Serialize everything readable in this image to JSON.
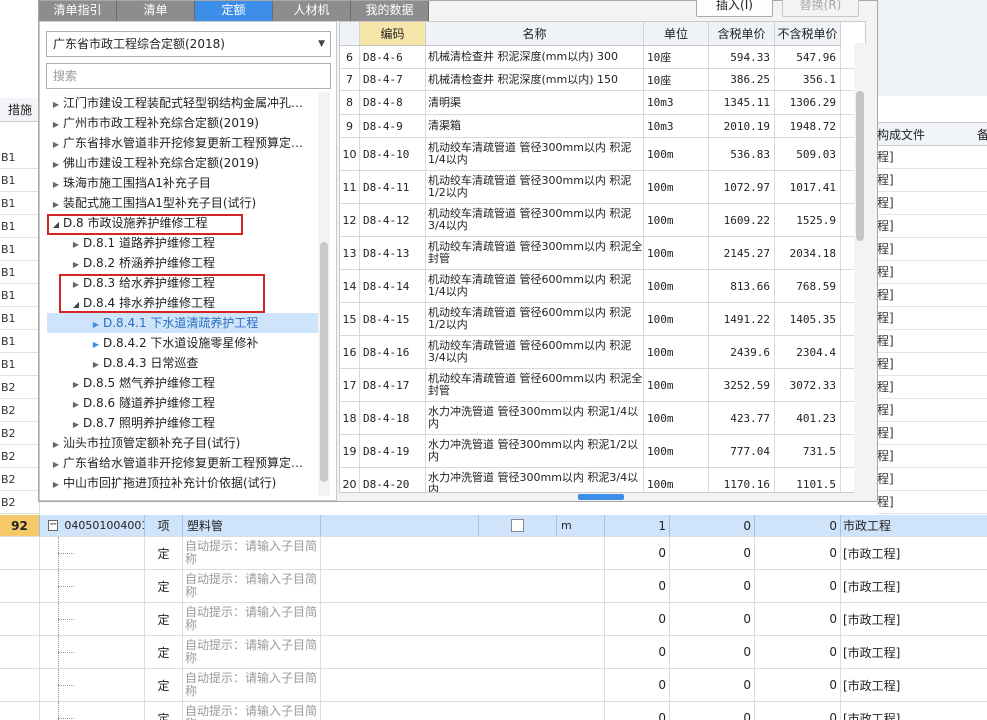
{
  "dialog": {
    "tabs": [
      "清单指引",
      "清单",
      "定额",
      "人材机",
      "我的数据"
    ],
    "active_tab": "定额",
    "insert_label": "插入(I)",
    "replace_label": "替换(R)",
    "library_select": "广东省市政工程综合定额(2018)",
    "search_placeholder": "搜索",
    "tree": [
      {
        "text": "江门市建设工程装配式轻型钢结构金属冲孔…",
        "arrow": "collapsed"
      },
      {
        "text": "广州市市政工程补充综合定额(2019)",
        "arrow": "collapsed"
      },
      {
        "text": "广东省排水管道非开挖修复更新工程预算定…",
        "arrow": "collapsed"
      },
      {
        "text": "佛山市建设工程补充综合定额(2019)",
        "arrow": "collapsed"
      },
      {
        "text": "珠海市施工围挡A1补充子目",
        "arrow": "collapsed"
      },
      {
        "text": "装配式施工围挡A1型补充子目(试行)",
        "arrow": "collapsed"
      },
      {
        "text": "D.8 市政设施养护维修工程",
        "arrow": "expanded"
      },
      {
        "text": "D.8.1 道路养护维修工程",
        "arrow": "collapsed"
      },
      {
        "text": "D.8.2 桥涵养护维修工程",
        "arrow": "collapsed"
      },
      {
        "text": "D.8.3 给水养护维修工程",
        "arrow": "collapsed"
      },
      {
        "text": "D.8.4 排水养护维修工程",
        "arrow": "expanded"
      },
      {
        "text": "D.8.4.1 下水道清疏养护工程",
        "arrow": "leaf-blue"
      },
      {
        "text": "D.8.4.2 下水道设施零星修补",
        "arrow": "leaf-blue"
      },
      {
        "text": "D.8.4.3 日常巡查",
        "arrow": "collapsed"
      },
      {
        "text": "D.8.5 燃气养护维修工程",
        "arrow": "collapsed"
      },
      {
        "text": "D.8.6 隧道养护维修工程",
        "arrow": "collapsed"
      },
      {
        "text": "D.8.7 照明养护维修工程",
        "arrow": "collapsed"
      },
      {
        "text": "汕头市拉顶管定额补充子目(试行)",
        "arrow": "collapsed"
      },
      {
        "text": "广东省给水管道非开挖修复更新工程预算定…",
        "arrow": "collapsed"
      },
      {
        "text": "中山市回扩拖进顶拉补充计价依据(试行)",
        "arrow": "collapsed"
      }
    ],
    "table": {
      "headers": [
        "编码",
        "名称",
        "单位",
        "含税单价",
        "不含税单价"
      ],
      "rows": [
        {
          "no": "6",
          "code": "D8-4-6",
          "name": "机械清检查井 积泥深度(mm以内) 300",
          "unit": "10座",
          "price_tax": "594.33",
          "price_notax": "547.96"
        },
        {
          "no": "7",
          "code": "D8-4-7",
          "name": "机械清检查井 积泥深度(mm以内) 150",
          "unit": "10座",
          "price_tax": "386.25",
          "price_notax": "356.1"
        },
        {
          "no": "8",
          "code": "D8-4-8",
          "name": "清明渠",
          "unit": "10m3",
          "price_tax": "1345.11",
          "price_notax": "1306.29"
        },
        {
          "no": "9",
          "code": "D8-4-9",
          "name": "清渠箱",
          "unit": "10m3",
          "price_tax": "2010.19",
          "price_notax": "1948.72"
        },
        {
          "no": "10",
          "code": "D8-4-10",
          "name": "机动绞车清疏管道 管径300mm以内 积泥1/4以内",
          "unit": "100m",
          "price_tax": "536.83",
          "price_notax": "509.03"
        },
        {
          "no": "11",
          "code": "D8-4-11",
          "name": "机动绞车清疏管道 管径300mm以内 积泥1/2以内",
          "unit": "100m",
          "price_tax": "1072.97",
          "price_notax": "1017.41"
        },
        {
          "no": "12",
          "code": "D8-4-12",
          "name": "机动绞车清疏管道 管径300mm以内 积泥3/4以内",
          "unit": "100m",
          "price_tax": "1609.22",
          "price_notax": "1525.9"
        },
        {
          "no": "13",
          "code": "D8-4-13",
          "name": "机动绞车清疏管道 管径300mm以内 积泥全封管",
          "unit": "100m",
          "price_tax": "2145.27",
          "price_notax": "2034.18"
        },
        {
          "no": "14",
          "code": "D8-4-14",
          "name": "机动绞车清疏管道 管径600mm以内 积泥1/4以内",
          "unit": "100m",
          "price_tax": "813.66",
          "price_notax": "768.59"
        },
        {
          "no": "15",
          "code": "D8-4-15",
          "name": "机动绞车清疏管道 管径600mm以内 积泥1/2以内",
          "unit": "100m",
          "price_tax": "1491.22",
          "price_notax": "1405.35"
        },
        {
          "no": "16",
          "code": "D8-4-16",
          "name": "机动绞车清疏管道 管径600mm以内 积泥3/4以内",
          "unit": "100m",
          "price_tax": "2439.6",
          "price_notax": "2304.4"
        },
        {
          "no": "17",
          "code": "D8-4-17",
          "name": "机动绞车清疏管道 管径600mm以内 积泥全封管",
          "unit": "100m",
          "price_tax": "3252.59",
          "price_notax": "3072.33"
        },
        {
          "no": "18",
          "code": "D8-4-18",
          "name": "水力冲洗管道 管径300mm以内 积泥1/4以内",
          "unit": "100m",
          "price_tax": "423.77",
          "price_notax": "401.23"
        },
        {
          "no": "19",
          "code": "D8-4-19",
          "name": "水力冲洗管道 管径300mm以内 积泥1/2以内",
          "unit": "100m",
          "price_tax": "777.04",
          "price_notax": "731.5"
        },
        {
          "no": "20",
          "code": "D8-4-20",
          "name": "水力冲洗管道 管径300mm以内 积泥3/4以内",
          "unit": "100m",
          "price_tax": "1170.16",
          "price_notax": "1101.5"
        }
      ]
    }
  },
  "background": {
    "left_tab": "措施",
    "left_ids": [
      "B1",
      "B1",
      "B1",
      "B1",
      "B1",
      "B1",
      "B1",
      "B1",
      "B1",
      "B1",
      "B2",
      "B2",
      "B2",
      "B2",
      "B2",
      "B2"
    ],
    "right_header": "构成文件",
    "right_header2": "备",
    "right_values": [
      "程]",
      "程]",
      "程]",
      "程]",
      "程]",
      "程]",
      "程]",
      "程]",
      "程]",
      "程]",
      "程]",
      "程]",
      "程]",
      "程]",
      "程]",
      "程]"
    ]
  },
  "grid": {
    "selected": {
      "num": "92",
      "code": "040501004001",
      "type": "项",
      "name": "塑料管",
      "unit": "m",
      "qty": "1",
      "v1": "0",
      "v2": "0",
      "file": "市政工程"
    },
    "children": [
      {
        "type": "定",
        "hint": "自动提示：请输入子目简称",
        "v1": "0",
        "v2": "0",
        "v3": "0",
        "file": "[市政工程]"
      },
      {
        "type": "定",
        "hint": "自动提示：请输入子目简称",
        "v1": "0",
        "v2": "0",
        "v3": "0",
        "file": "[市政工程]"
      },
      {
        "type": "定",
        "hint": "自动提示：请输入子目简称",
        "v1": "0",
        "v2": "0",
        "v3": "0",
        "file": "[市政工程]"
      },
      {
        "type": "定",
        "hint": "自动提示：请输入子目简称",
        "v1": "0",
        "v2": "0",
        "v3": "0",
        "file": "[市政工程]"
      },
      {
        "type": "定",
        "hint": "自动提示：请输入子目简称",
        "v1": "0",
        "v2": "0",
        "v3": "0",
        "file": "[市政工程]"
      },
      {
        "type": "定",
        "hint": "自动提示：请输入子目简称",
        "v1": "0",
        "v2": "0",
        "v3": "0",
        "file": "[市政工程]"
      }
    ]
  }
}
